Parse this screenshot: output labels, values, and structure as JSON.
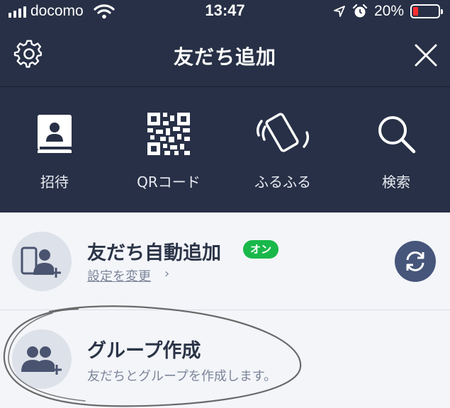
{
  "status_bar": {
    "carrier": "docomo",
    "time": "13:47",
    "battery_percent": "20%",
    "battery_level": 0.2,
    "icons": [
      "signal-icon",
      "wifi-icon",
      "location-icon",
      "alarm-icon",
      "battery-icon"
    ]
  },
  "header": {
    "title": "友だち追加",
    "left_icon": "gear-icon",
    "right_icon": "close-icon"
  },
  "options": [
    {
      "label": "招待",
      "icon": "contact-book-icon"
    },
    {
      "label": "QRコード",
      "icon": "qr-code-icon"
    },
    {
      "label": "ふるふる",
      "icon": "shaking-phone-icon"
    },
    {
      "label": "検索",
      "icon": "search-icon"
    }
  ],
  "list": {
    "auto_add": {
      "title": "友だち自動追加",
      "badge": "オン",
      "link": "設定を変更",
      "chevron": "›",
      "icon": "phone-add-friend-icon",
      "action_icon": "sync-icon"
    },
    "create_group": {
      "title": "グループ作成",
      "subtitle": "友だちとグループを作成します。",
      "icon": "add-group-icon"
    }
  },
  "colors": {
    "header_bg": "#273046",
    "list_bg": "#f3f5f9",
    "badge_green": "#19b84a",
    "sync_button": "#46557a",
    "battery_low": "#ff2d2d"
  }
}
